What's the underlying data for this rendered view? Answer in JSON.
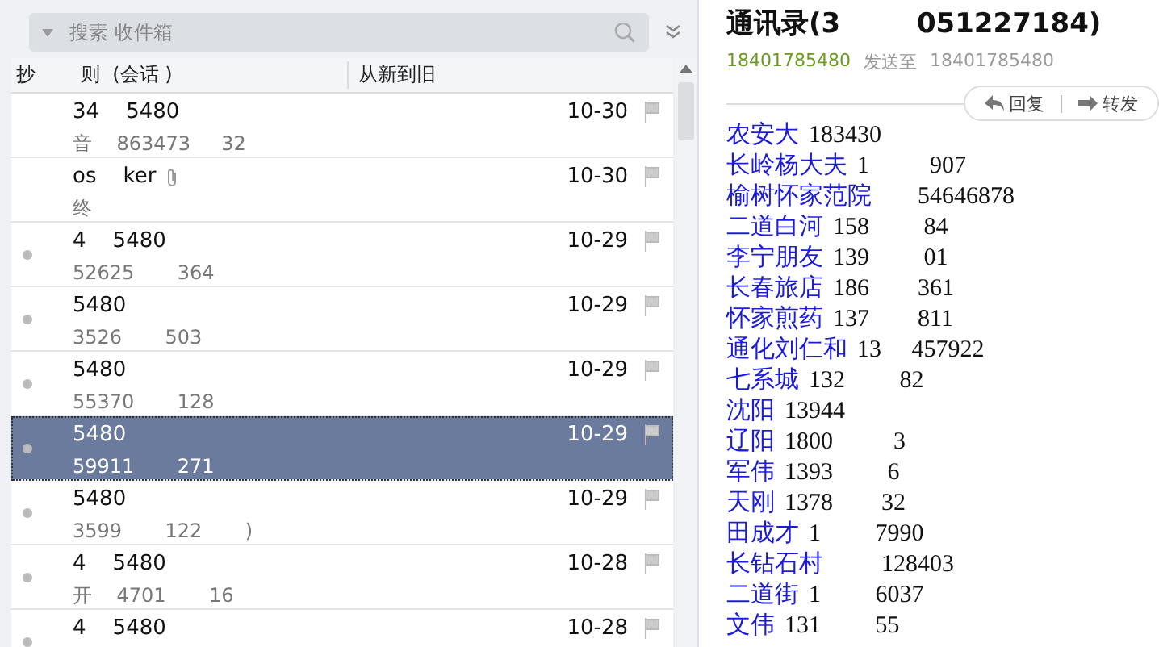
{
  "search": {
    "placeholder": "搜素 收件箱"
  },
  "columns": [
    "抄",
    "则  (会话 )",
    "从新到旧"
  ],
  "messages": [
    {
      "sender": "34    5480",
      "preview": "音    863473     32",
      "date": "10-30",
      "unread": false,
      "attachment": false,
      "selected": false
    },
    {
      "sender": "os    ker",
      "preview": "终",
      "date": "10-30",
      "unread": false,
      "attachment": true,
      "selected": false
    },
    {
      "sender": "4    5480",
      "preview": "52625       364",
      "date": "10-29",
      "unread": true,
      "attachment": false,
      "selected": false
    },
    {
      "sender": "5480",
      "preview": "3526       503",
      "date": "10-29",
      "unread": true,
      "attachment": false,
      "selected": false
    },
    {
      "sender": "5480",
      "preview": "55370       128",
      "date": "10-29",
      "unread": true,
      "attachment": false,
      "selected": false
    },
    {
      "sender": "5480",
      "preview": "59911       271",
      "date": "10-29",
      "unread": true,
      "attachment": false,
      "selected": true
    },
    {
      "sender": "5480",
      "preview": "3599       122       )",
      "date": "10-29",
      "unread": true,
      "attachment": false,
      "selected": false
    },
    {
      "sender": "4    5480",
      "preview": "开    4701       16",
      "date": "10-28",
      "unread": true,
      "attachment": false,
      "selected": false
    },
    {
      "sender": "4    5480",
      "date": "10-28",
      "unread": true,
      "attachment": false,
      "selected": false
    }
  ],
  "mail": {
    "title": "通讯录(3        051227184)",
    "from": "18401785480",
    "to_label": "发送至",
    "to": "18401785480",
    "actions": [
      "回复",
      "转发"
    ],
    "contacts": [
      {
        "name": "农安大",
        "number": "183430"
      },
      {
        "name": "长岭杨大夫",
        "number": "1          907"
      },
      {
        "name": "榆树怀家范院",
        "number": "      54646878"
      },
      {
        "name": "二道白河",
        "number": "158         84"
      },
      {
        "name": "李宁朋友",
        "number": "139         01"
      },
      {
        "name": "长春旅店",
        "number": "186        361"
      },
      {
        "name": "怀家煎药",
        "number": "137        811"
      },
      {
        "name": "通化刘仁和",
        "number": "13     457922"
      },
      {
        "name": "七系城",
        "number": "132         82"
      },
      {
        "name": "沈阳",
        "number": "13944"
      },
      {
        "name": "辽阳",
        "number": "1800          3"
      },
      {
        "name": "军伟",
        "number": "1393         6"
      },
      {
        "name": "天刚",
        "number": "1378        32"
      },
      {
        "name": "田成才",
        "number": "1         7990"
      },
      {
        "name": "长钻石村",
        "number": "        128403"
      },
      {
        "name": "二道街",
        "number": "1         6037"
      },
      {
        "name": "文伟",
        "number": "131         55"
      }
    ]
  }
}
